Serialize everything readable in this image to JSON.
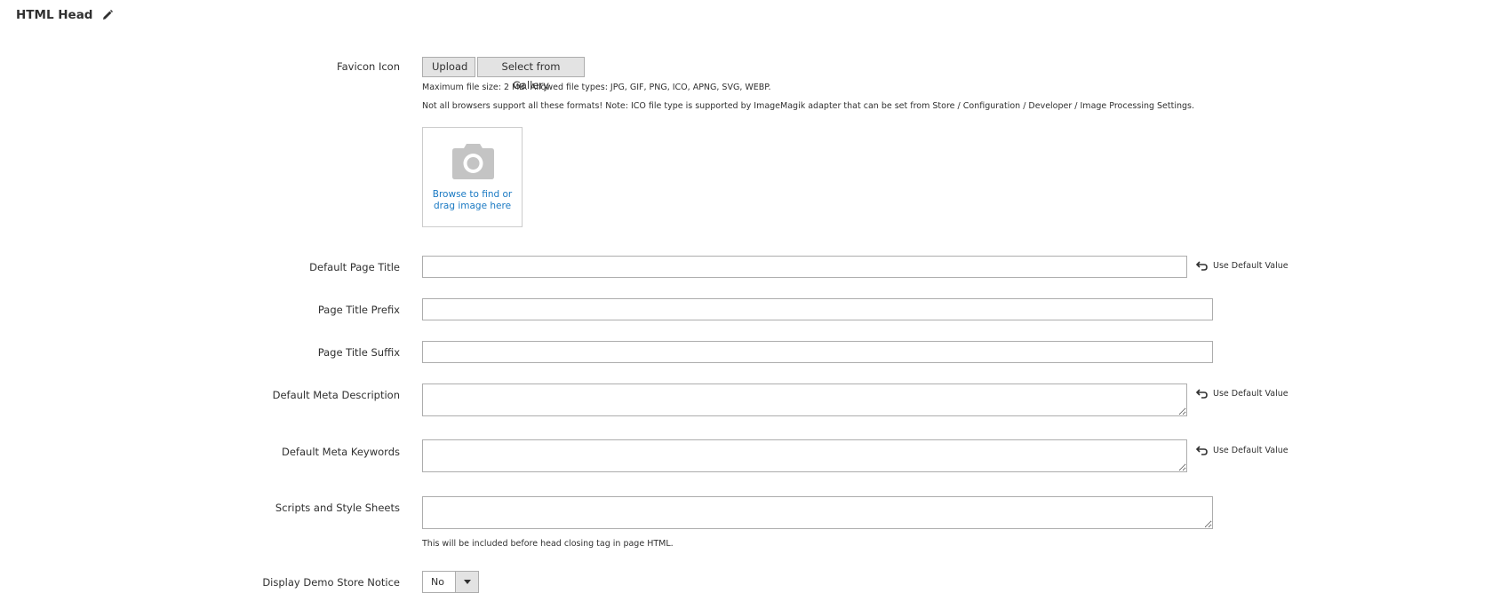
{
  "section": {
    "title": "HTML Head"
  },
  "favicon": {
    "label": "Favicon Icon",
    "upload_label": "Upload",
    "gallery_label": "Select from Gallery",
    "note_size": "Maximum file size: 2 MB. Allowed file types: JPG, GIF, PNG, ICO, APNG, SVG, WEBP.",
    "note_browsers": "Not all browsers support all these formats! Note: ICO file type is supported by ImageMagik adapter that can be set from Store / Configuration / Developer / Image Processing Settings.",
    "browse_text": "Browse to find or drag image here"
  },
  "fields": {
    "default_page_title": {
      "label": "Default Page Title",
      "value": ""
    },
    "page_title_prefix": {
      "label": "Page Title Prefix",
      "value": ""
    },
    "page_title_suffix": {
      "label": "Page Title Suffix",
      "value": ""
    },
    "default_meta_description": {
      "label": "Default Meta Description",
      "value": ""
    },
    "default_meta_keywords": {
      "label": "Default Meta Keywords",
      "value": ""
    },
    "scripts_and_style_sheets": {
      "label": "Scripts and Style Sheets",
      "value": "",
      "note": "This will be included before head closing tag in page HTML."
    },
    "display_demo_store_notice": {
      "label": "Display Demo Store Notice",
      "value": "No"
    }
  },
  "use_default_label": "Use Default Value",
  "colors": {
    "link": "#1979c3",
    "button_bg": "#e3e3e3",
    "border": "#adadad",
    "icon_gray": "#c4c4c4"
  },
  "icons": {
    "edit": "pencil-icon",
    "placeholder": "camera-icon",
    "revert": "undo-arrow-icon",
    "dropdown": "caret-down-icon"
  }
}
